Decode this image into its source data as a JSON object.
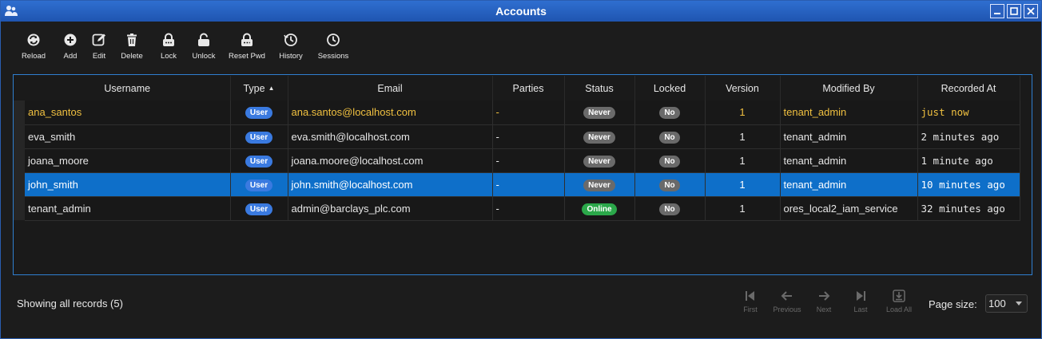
{
  "window": {
    "title": "Accounts"
  },
  "toolbar": {
    "items": [
      {
        "label": "Reload",
        "icon": "reload-icon"
      },
      {
        "label": "Add",
        "icon": "add-icon"
      },
      {
        "label": "Edit",
        "icon": "edit-icon"
      },
      {
        "label": "Delete",
        "icon": "trash-icon"
      },
      {
        "label": "Lock",
        "icon": "lock-icon"
      },
      {
        "label": "Unlock",
        "icon": "unlock-icon"
      },
      {
        "label": "Reset Pwd",
        "icon": "reset-password-icon"
      },
      {
        "label": "History",
        "icon": "history-icon"
      },
      {
        "label": "Sessions",
        "icon": "sessions-icon"
      }
    ]
  },
  "table": {
    "columns": [
      "Username",
      "Type",
      "Email",
      "Parties",
      "Status",
      "Locked",
      "Version",
      "Modified By",
      "Recorded At"
    ],
    "sort_arrow": "▲",
    "rows": [
      {
        "username": "ana_santos",
        "type": "User",
        "email": "ana.santos@localhost.com",
        "parties": "-",
        "status": "Never",
        "locked": "No",
        "version": "1",
        "modified_by": "tenant_admin",
        "recorded_at": "just now"
      },
      {
        "username": "eva_smith",
        "type": "User",
        "email": "eva.smith@localhost.com",
        "parties": "-",
        "status": "Never",
        "locked": "No",
        "version": "1",
        "modified_by": "tenant_admin",
        "recorded_at": "2 minutes ago"
      },
      {
        "username": "joana_moore",
        "type": "User",
        "email": "joana.moore@localhost.com",
        "parties": "-",
        "status": "Never",
        "locked": "No",
        "version": "1",
        "modified_by": "tenant_admin",
        "recorded_at": "1 minute ago"
      },
      {
        "username": "john_smith",
        "type": "User",
        "email": "john.smith@localhost.com",
        "parties": "-",
        "status": "Never",
        "locked": "No",
        "version": "1",
        "modified_by": "tenant_admin",
        "recorded_at": "10 minutes ago"
      },
      {
        "username": "tenant_admin",
        "type": "User",
        "email": "admin@barclays_plc.com",
        "parties": "-",
        "status": "Online",
        "locked": "No",
        "version": "1",
        "modified_by": "ores_local2_iam_service",
        "recorded_at": "32 minutes ago"
      }
    ]
  },
  "footer": {
    "status": "Showing all records (5)",
    "pager": [
      "First",
      "Previous",
      "Next",
      "Last",
      "Load All"
    ],
    "page_size_label": "Page size:",
    "page_size_value": "100"
  },
  "colors": {
    "accent": "#0e6fc9",
    "titlebar": "#2a62c4",
    "new_row_text": "#f0c040",
    "online": "#2ba84a",
    "user_badge": "#3a7ae0"
  }
}
